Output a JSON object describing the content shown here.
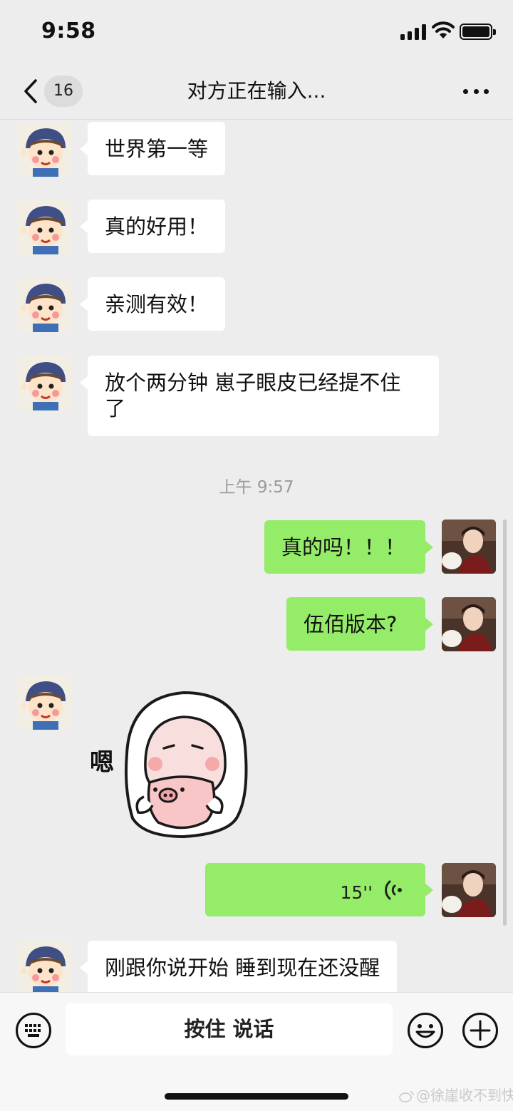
{
  "status_bar": {
    "time": "9:58"
  },
  "header": {
    "back_badge": "16",
    "title": "对方正在输入..."
  },
  "messages": {
    "m1": "世界第一等",
    "m2": "真的好用！",
    "m3": "亲测有效！",
    "m4_line1": "放个两分钟 崽子眼皮已经提不住",
    "m4_line2": "了",
    "time_divider": "上午 9:57",
    "m5": "真的吗！！！",
    "m6": "伍佰版本?",
    "sticker_text": "嗯",
    "voice_duration": "15''",
    "m8": "刚跟你说开始 睡到现在还没醒"
  },
  "input_bar": {
    "hold_to_talk": "按住 说话"
  },
  "watermark": {
    "text": "@徐崖收不到快递"
  },
  "colors": {
    "background": "#ededed",
    "sent_bubble": "#95ec69",
    "received_bubble": "#ffffff"
  }
}
